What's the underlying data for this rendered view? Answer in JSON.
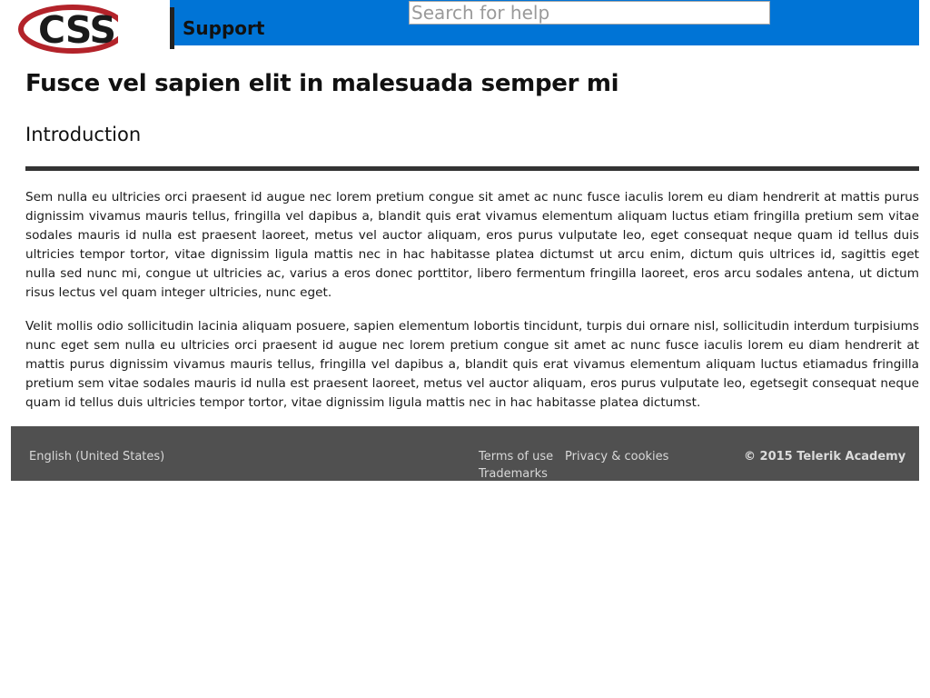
{
  "header": {
    "logo_text": "CSS",
    "brand_label": "Support",
    "search_placeholder": "Search for help",
    "colors": {
      "bar": "#0074d6",
      "logo_swoosh": "#b3232a",
      "logo_text": "#1a1a1a"
    }
  },
  "article": {
    "title": "Fusce vel sapien elit in malesuada semper mi",
    "section_heading": "Introduction",
    "paragraphs": [
      "Sem nulla eu ultricies orci praesent id augue nec lorem pretium congue sit amet ac nunc fusce iaculis lorem eu diam hendrerit at mattis purus dignissim vivamus mauris tellus, fringilla vel dapibus a, blandit quis erat vivamus elementum aliquam luctus etiam fringilla pretium sem vitae sodales mauris id nulla est praesent laoreet, metus vel auctor aliquam, eros purus vulputate leo, eget consequat neque quam id tellus duis ultricies tempor tortor, vitae dignissim ligula mattis nec in hac habitasse platea dictumst ut arcu enim, dictum quis ultrices id, sagittis eget nulla sed nunc mi, congue ut ultricies ac, varius a eros donec porttitor, libero fermentum fringilla laoreet, eros arcu sodales antena, ut dictum risus lectus vel quam integer ultricies, nunc eget.",
      "Velit mollis odio sollicitudin lacinia aliquam posuere, sapien elementum lobortis tincidunt, turpis dui ornare nisl, sollicitudin interdum turpisiums nunc eget sem nulla eu ultricies orci praesent id augue nec lorem pretium congue sit amet ac nunc fusce iaculis lorem eu diam hendrerit at mattis purus dignissim vivamus mauris tellus, fringilla vel dapibus a, blandit quis erat vivamus elementum aliquam luctus etiamadus fringilla pretium sem vitae sodales mauris id nulla est praesent laoreet, metus vel auctor aliquam, eros purus vulputate leo, egetsegit consequat neque quam id tellus duis ultricies tempor tortor, vitae dignissim ligula mattis nec in hac habitasse platea dictumst."
    ]
  },
  "footer": {
    "language": "English (United States)",
    "links": {
      "terms": "Terms of use",
      "privacy": "Privacy & cookies",
      "trademarks": "Trademarks"
    },
    "copyright": "© 2015 Telerik Academy",
    "colors": {
      "background": "#505050",
      "text": "#d8d8d8"
    }
  }
}
